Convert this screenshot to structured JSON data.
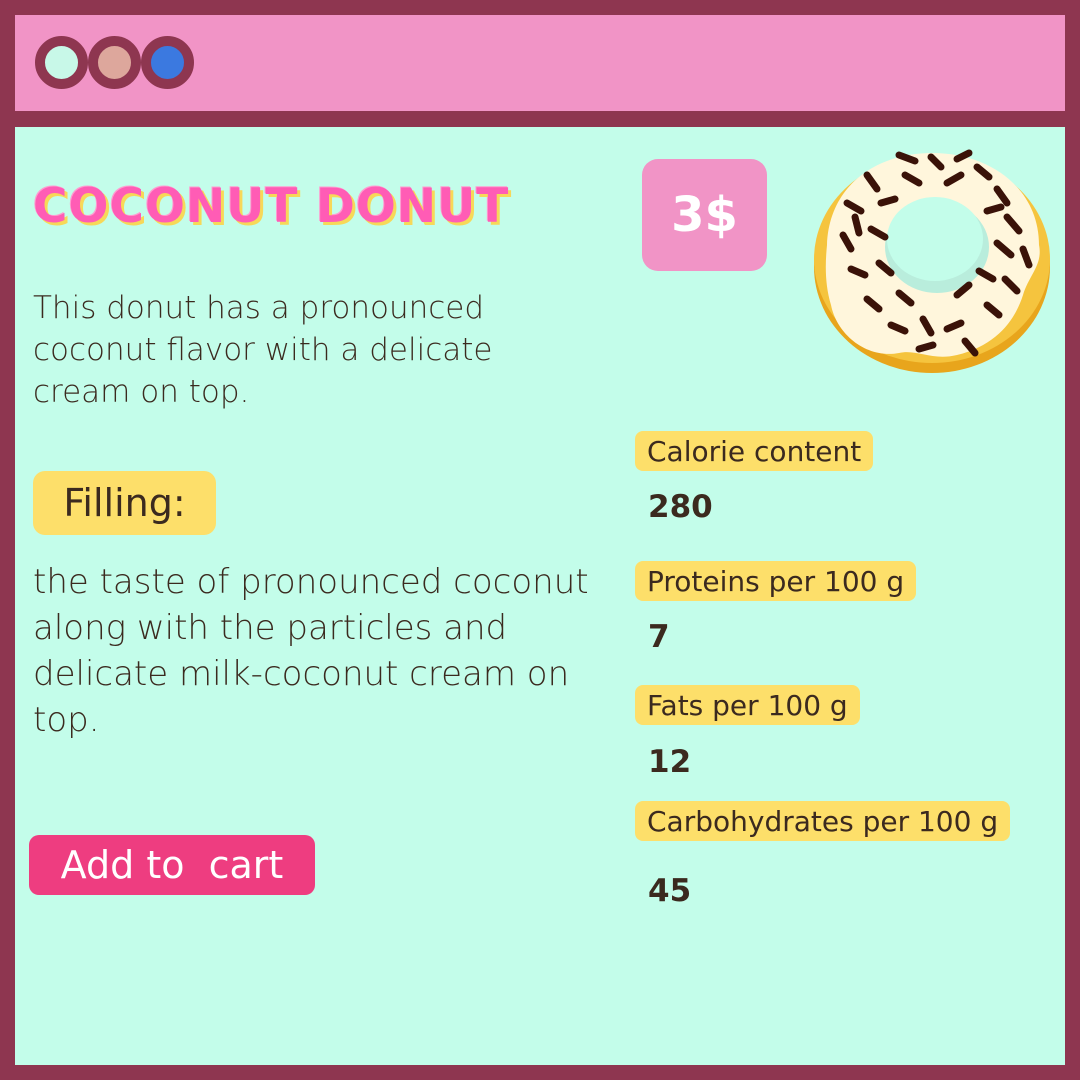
{
  "window": {
    "title_dots": [
      {
        "name": "close",
        "color": "#c8f8e8"
      },
      {
        "name": "minimize",
        "color": "#dda79c"
      },
      {
        "name": "maximize",
        "color": "#3b79e0"
      }
    ]
  },
  "product": {
    "title": "COCONUT DONUT",
    "price": "3$",
    "description": "This donut has a pronounced coconut flavor with a delicate cream on top.",
    "filling_label": "Filling:",
    "filling_text": "the taste of pronounced coconut along with the particles and delicate milk-coconut cream on top.",
    "add_to_cart": "Add to  cart",
    "image": "donut-icon"
  },
  "nutrition": {
    "calories_label": "Calorie content",
    "calories_value": "280",
    "proteins_label": "Proteins per 100 g",
    "proteins_value": "7",
    "fats_label": "Fats per 100 g",
    "fats_value": "12",
    "carbs_label": "Carbohydrates per 100 g",
    "carbs_value": "45"
  },
  "colors": {
    "frame": "#8e3650",
    "titlebar": "#f194c6",
    "background": "#c3fdea",
    "accent": "#ee3d80",
    "tag": "#fddf6a"
  }
}
